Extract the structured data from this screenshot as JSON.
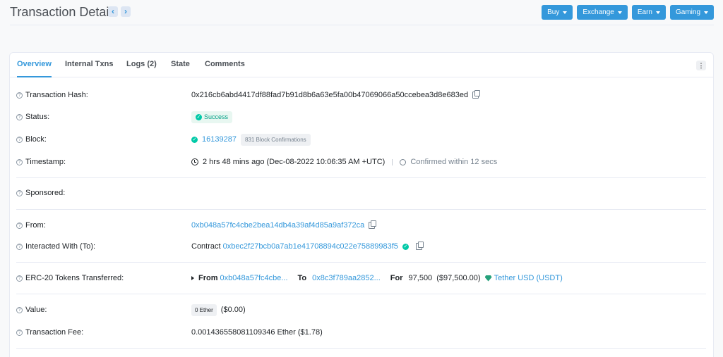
{
  "header": {
    "title": "Transaction Details",
    "prev_icon": "chevron-left-icon",
    "next_icon": "chevron-right-icon",
    "buttons": [
      "Buy",
      "Exchange",
      "Earn",
      "Gaming"
    ]
  },
  "tabs": [
    "Overview",
    "Internal Txns",
    "Logs (2)",
    "State",
    "Comments"
  ],
  "fields": {
    "tx_hash": {
      "label": "Transaction Hash:",
      "value": "0x216cb6abd4417df88fad7b91d8b6a63e5fa00b47069066a50ccebea3d8e683ed"
    },
    "status": {
      "label": "Status:",
      "value": "Success"
    },
    "block": {
      "label": "Block:",
      "value": "16139287",
      "confirmations": "831 Block Confirmations"
    },
    "timestamp": {
      "label": "Timestamp:",
      "value": "2 hrs 48 mins ago (Dec-08-2022 10:06:35 AM +UTC)",
      "confirmed": "Confirmed within 12 secs"
    },
    "sponsored": {
      "label": "Sponsored:"
    },
    "from": {
      "label": "From:",
      "value": "0xb048a57fc4cbe2bea14db4a39af4d85a9af372ca"
    },
    "interacted": {
      "label": "Interacted With (To):",
      "prefix": "Contract",
      "value": "0xbec2f27bcb0a7ab1e41708894c022e75889983f5"
    },
    "erc20": {
      "label": "ERC-20 Tokens Transferred:",
      "from_label": "From",
      "from_value": "0xb048a57fc4cbe...",
      "to_label": "To",
      "to_value": "0x8c3f789aa2852...",
      "for_label": "For",
      "amount": "97,500",
      "usd": "($97,500.00)",
      "token": "Tether USD (USDT)"
    },
    "value": {
      "label": "Value:",
      "badge": "0 Ether",
      "usd": "($0.00)"
    },
    "fee": {
      "label": "Transaction Fee:",
      "value": "0.001436558081109346 Ether ($1.78)"
    }
  },
  "colors": {
    "accent": "#3498db",
    "success": "#00c9a7",
    "tether": "#26a17b"
  }
}
